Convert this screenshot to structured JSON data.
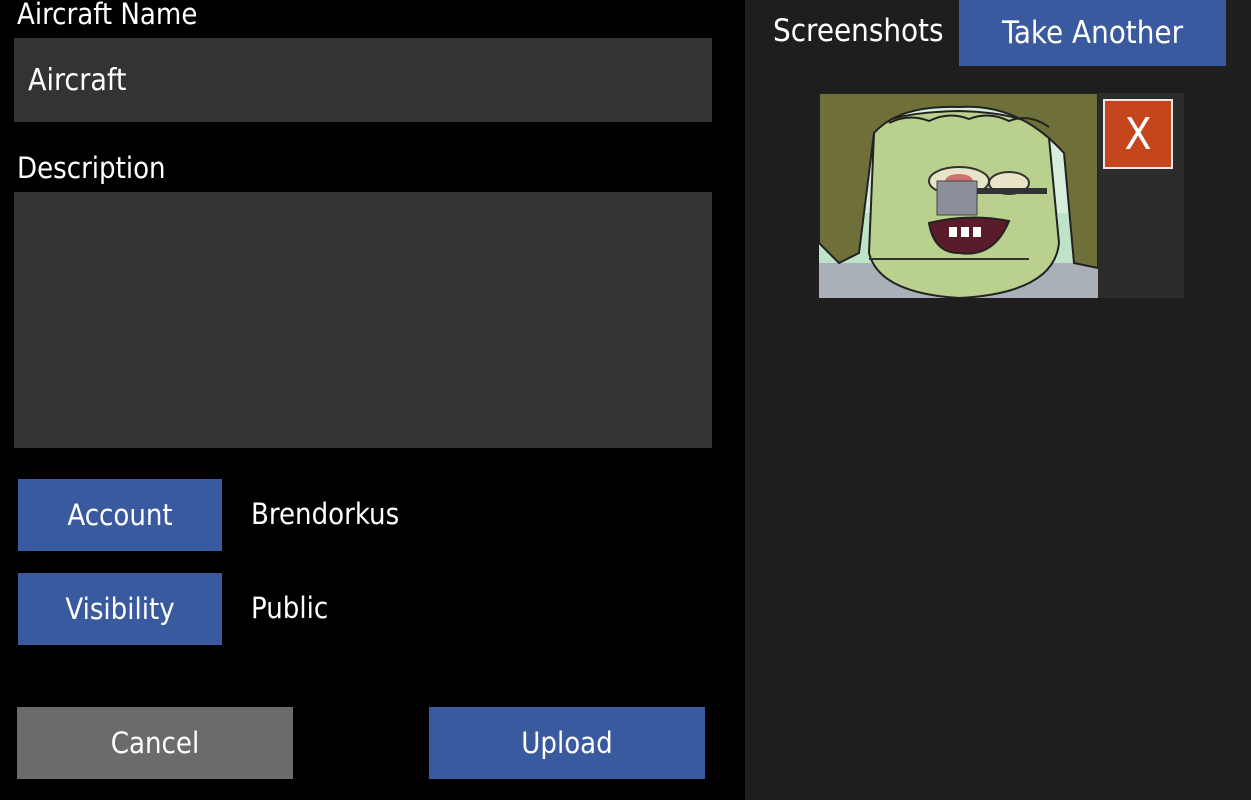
{
  "form": {
    "name_label": "Aircraft Name",
    "name_value": "Aircraft",
    "description_label": "Description",
    "description_value": "",
    "account_button": "Account",
    "account_value": "Brendorkus",
    "visibility_button": "Visibility",
    "visibility_value": "Public",
    "cancel_button": "Cancel",
    "upload_button": "Upload"
  },
  "screenshots": {
    "title": "Screenshots",
    "take_another_button": "Take Another",
    "delete_button": "X",
    "items": [
      {
        "thumbnail_icon": "cartoon-character-screenshot"
      }
    ]
  },
  "colors": {
    "background": "#000000",
    "panel": "#1e1e1e",
    "field": "#333333",
    "accent_blue": "#3a5a9f",
    "cancel_gray": "#6b6b6b",
    "delete_red": "#c5451d"
  }
}
